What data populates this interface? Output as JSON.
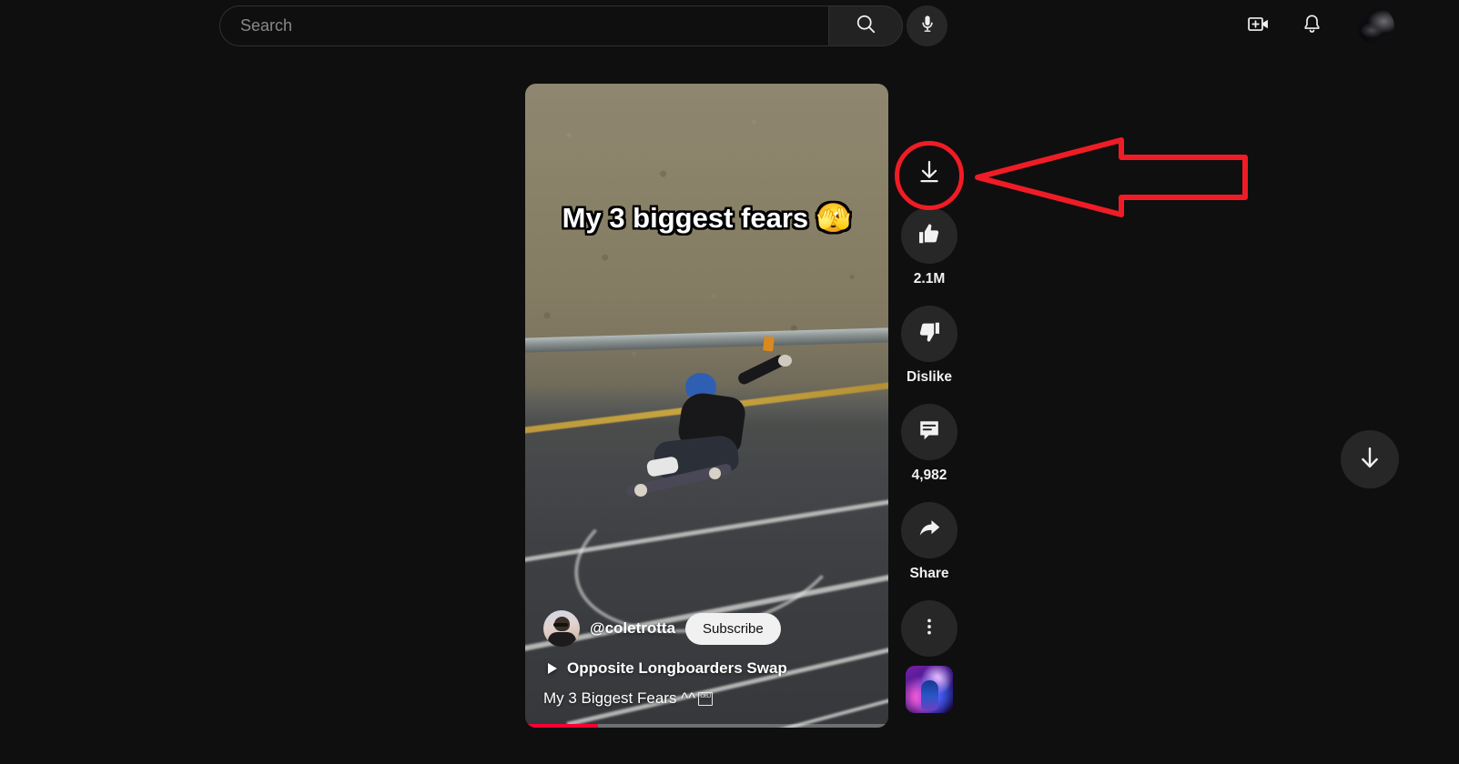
{
  "header": {
    "search": {
      "placeholder": "Search",
      "value": "",
      "search_icon": "search-icon",
      "mic_icon": "microphone-icon"
    },
    "create_icon": "create-video-icon",
    "notifications_icon": "notification-bell-icon",
    "avatar": "account-avatar"
  },
  "player": {
    "caption": "My 3 biggest fears 🫣",
    "channel": {
      "handle": "@coletrotta",
      "subscribe_label": "Subscribe",
      "avatar": "channel-avatar"
    },
    "title": "Opposite Longboarders Swap",
    "title_play_icon": "play-triangle-icon",
    "description": "My 3 Biggest Fears ^^",
    "description_tofu": "OBJ",
    "progress_percent": 20
  },
  "actions": [
    {
      "name": "download",
      "icon": "download-icon",
      "label": "",
      "highlighted": true
    },
    {
      "name": "like",
      "icon": "thumbs-up-icon",
      "label": "2.1M",
      "highlighted": false
    },
    {
      "name": "dislike",
      "icon": "thumbs-down-icon",
      "label": "Dislike",
      "highlighted": false
    },
    {
      "name": "comments",
      "icon": "comment-icon",
      "label": "4,982",
      "highlighted": false
    },
    {
      "name": "share",
      "icon": "share-icon",
      "label": "Share",
      "highlighted": false
    },
    {
      "name": "more-options",
      "icon": "more-vertical-icon",
      "label": "",
      "highlighted": false
    },
    {
      "name": "sound-thumbnail",
      "icon": "sound-thumbnail-icon",
      "label": "",
      "highlighted": false
    }
  ],
  "navigation": {
    "next_icon": "arrow-down-icon"
  },
  "annotation": {
    "color": "#f01c25",
    "shape_circle": "highlight-circle",
    "shape_arrow": "pointer-arrow-left",
    "target": "download-button"
  },
  "colors": {
    "background": "#0f0f0f",
    "surface": "#272727",
    "text_primary": "#f1f1f1",
    "accent_red": "#ff0033",
    "annotation_red": "#f01c25"
  }
}
